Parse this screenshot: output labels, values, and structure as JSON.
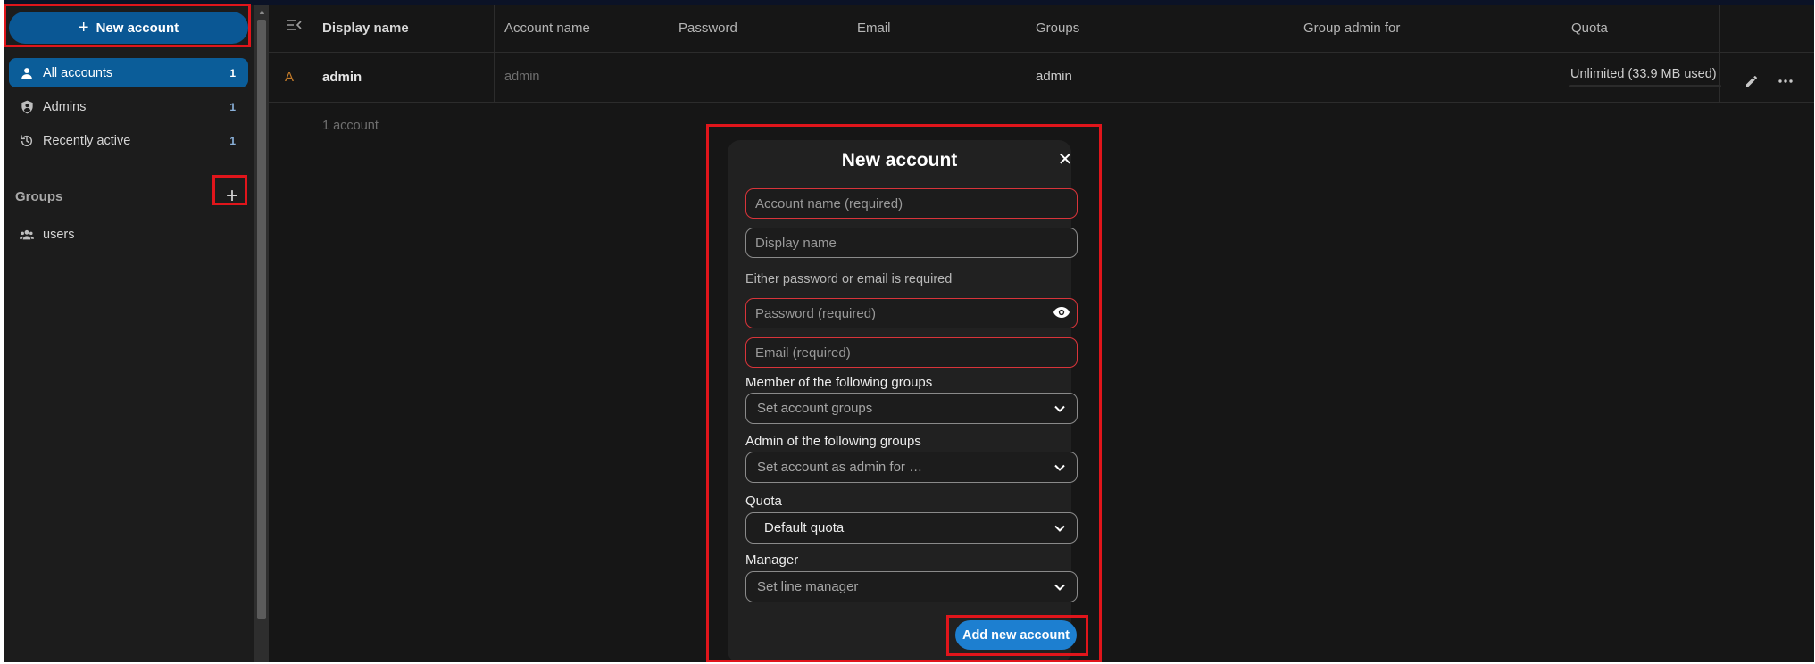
{
  "sidebar": {
    "new_account_label": "New account",
    "nav": [
      {
        "label": "All accounts",
        "count": "1",
        "icon": "account-icon"
      },
      {
        "label": "Admins",
        "count": "1",
        "icon": "shield-account-icon"
      },
      {
        "label": "Recently active",
        "count": "1",
        "icon": "history-icon"
      }
    ],
    "groups_heading": "Groups",
    "groups": [
      {
        "label": "users",
        "icon": "account-group-icon"
      }
    ]
  },
  "table": {
    "columns": {
      "display_name": "Display name",
      "account_name": "Account name",
      "password": "Password",
      "email": "Email",
      "groups": "Groups",
      "group_admin_for": "Group admin for",
      "quota": "Quota"
    },
    "rows": [
      {
        "avatar": "A",
        "display_name": "admin",
        "account_name": "admin",
        "groups": "admin",
        "quota_text": "Unlimited (33.9 MB used)",
        "quota_fill": 0
      }
    ],
    "count_text": "1 account"
  },
  "dialog": {
    "title": "New account",
    "account_name_placeholder": "Account name (required)",
    "display_name_placeholder": "Display name",
    "password_hint": "Either password or email is required",
    "password_placeholder": "Password (required)",
    "email_placeholder": "Email (required)",
    "groups_label": "Member of the following groups",
    "groups_placeholder": "Set account groups",
    "admin_label": "Admin of the following groups",
    "admin_placeholder": "Set account as admin for …",
    "quota_label": "Quota",
    "quota_value": "Default quota",
    "manager_label": "Manager",
    "manager_placeholder": "Set line manager",
    "submit_label": "Add new account"
  },
  "colors": {
    "primary": "#0b5d99",
    "button_primary": "#1d7fd0",
    "highlight_box": "#e0151b",
    "required_border": "#d8343a",
    "background": "#171717"
  }
}
